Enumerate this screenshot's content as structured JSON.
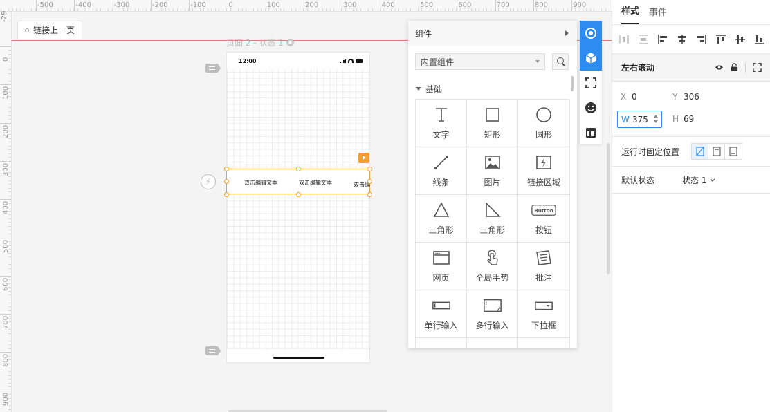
{
  "ruler": {
    "top_labels": [
      "-500",
      "-400",
      "-300",
      "-200",
      "-100",
      "0",
      "100",
      "200",
      "300",
      "400",
      "500",
      "600",
      "700",
      "800",
      "900"
    ],
    "left_labels": [
      "0",
      "100",
      "200",
      "300",
      "400",
      "500",
      "600",
      "700",
      "800",
      "900"
    ],
    "corner_value": "-29"
  },
  "canvas": {
    "link_prev": "链接上一页",
    "page_title": "页面 2 - 状态 1",
    "phone_time": "12:00",
    "scroll_texts": [
      "双击编辑文本",
      "双击编辑文本",
      "双击编"
    ]
  },
  "component_panel": {
    "title": "组件",
    "library_select": "内置组件",
    "category": "基础",
    "items": [
      {
        "label": "文字",
        "icon": "text-icon"
      },
      {
        "label": "矩形",
        "icon": "rectangle-icon"
      },
      {
        "label": "圆形",
        "icon": "circle-icon"
      },
      {
        "label": "线条",
        "icon": "line-icon"
      },
      {
        "label": "图片",
        "icon": "image-icon"
      },
      {
        "label": "链接区域",
        "icon": "link-area-icon"
      },
      {
        "label": "三角形",
        "icon": "triangle-icon"
      },
      {
        "label": "三角形",
        "icon": "right-triangle-icon"
      },
      {
        "label": "按钮",
        "icon": "button-icon"
      },
      {
        "label": "网页",
        "icon": "webpage-icon"
      },
      {
        "label": "全局手势",
        "icon": "gesture-icon"
      },
      {
        "label": "批注",
        "icon": "note-icon"
      },
      {
        "label": "单行输入",
        "icon": "single-input-icon"
      },
      {
        "label": "多行输入",
        "icon": "multiline-input-icon"
      },
      {
        "label": "下拉框",
        "icon": "dropdown-icon"
      }
    ],
    "button_icon_text": "Button"
  },
  "right_panel": {
    "tabs": [
      "样式",
      "事件"
    ],
    "active_tab": "样式",
    "component_name": "左右滚动",
    "x_label": "X",
    "x_value": "0",
    "y_label": "Y",
    "y_value": "306",
    "w_label": "W",
    "w_value": "375",
    "h_label": "H",
    "h_value": "69",
    "fixed_position_label": "运行时固定位置",
    "default_state_label": "默认状态",
    "default_state_value": "状态 1"
  },
  "colors": {
    "accent": "#2d8cf0",
    "selection": "#f0a030",
    "guide": "#e07a6a"
  }
}
